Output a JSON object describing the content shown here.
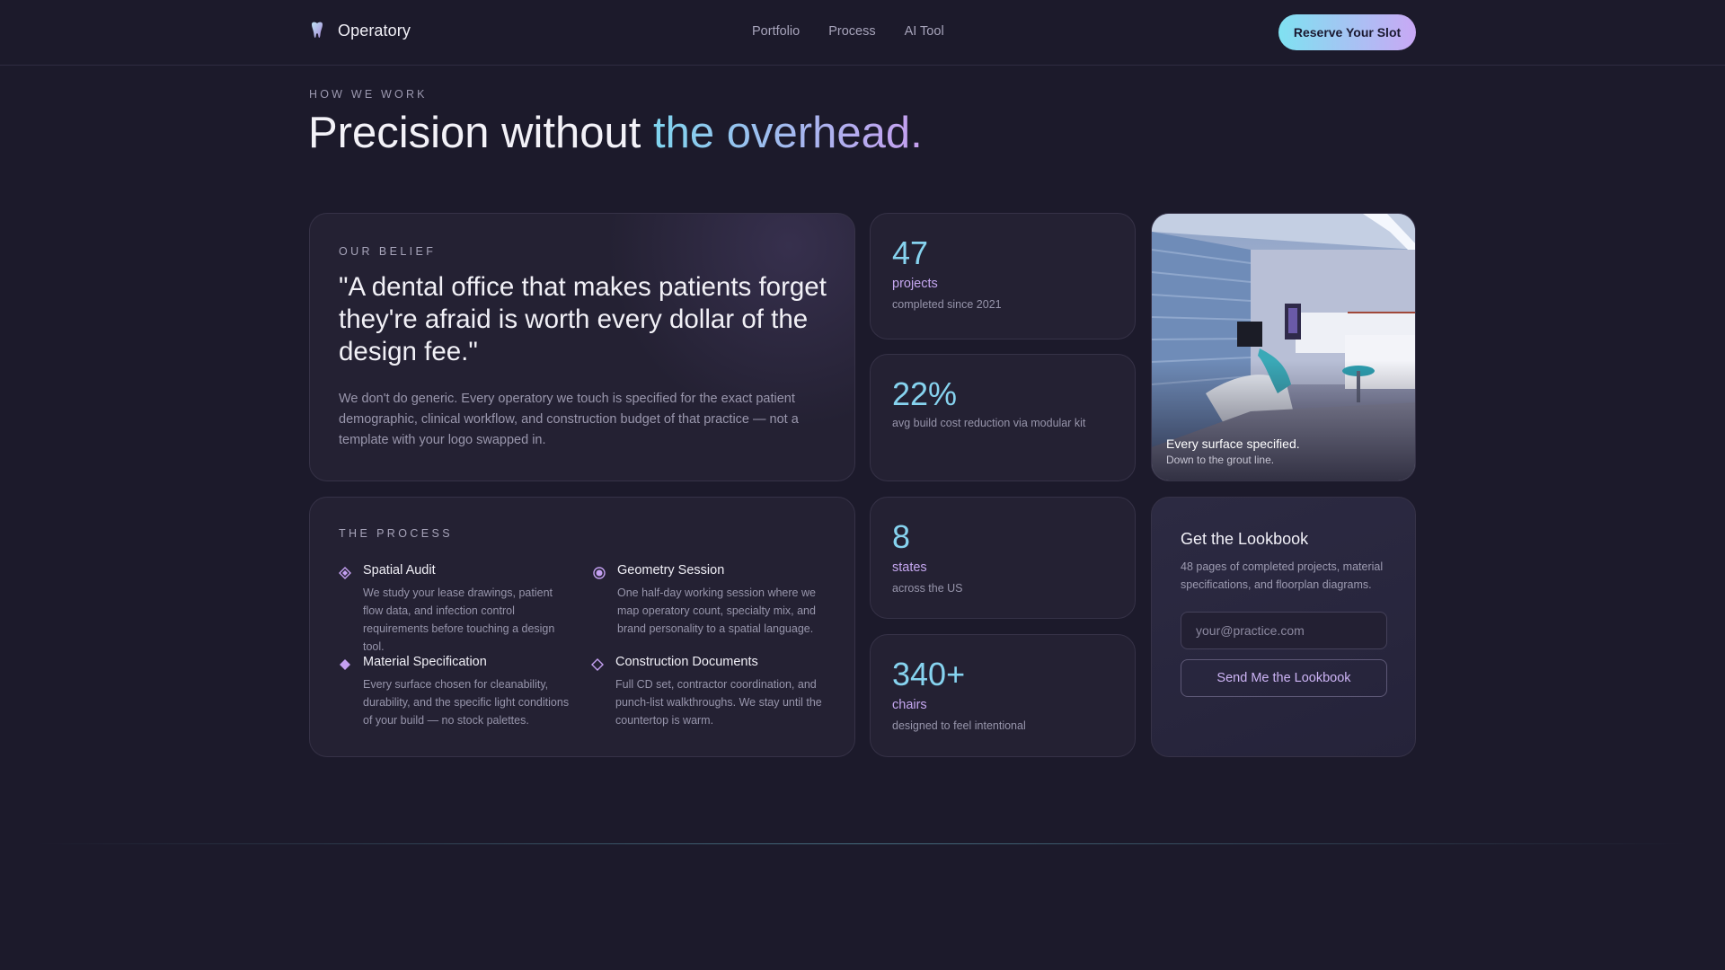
{
  "nav": {
    "brand": "Operatory",
    "links": [
      "Portfolio",
      "Process",
      "AI Tool"
    ],
    "cta": "Reserve Your Slot"
  },
  "hero": {
    "eyebrow": "HOW WE WORK",
    "headline_plain": "Precision without ",
    "headline_accent": "the overhead."
  },
  "belief": {
    "eyebrow": "OUR BELIEF",
    "quote": "\"A dental office that makes patients forget they're afraid is worth every dollar of the design fee.\"",
    "body": "We don't do generic. Every operatory we touch is specified for the exact patient demographic, clinical workflow, and construction budget of that practice — not a template with your logo swapped in."
  },
  "stats": [
    {
      "value": "47",
      "label": "projects",
      "sub": "completed since 2021"
    },
    {
      "value": "22%",
      "label": "",
      "sub": "avg build cost reduction via modular kit"
    },
    {
      "value": "8",
      "label": "states",
      "sub": "across the US"
    },
    {
      "value": "340+",
      "label": "chairs",
      "sub": "designed to feel intentional"
    }
  ],
  "photo": {
    "title": "Every surface specified.",
    "subtitle": "Down to the grout line."
  },
  "process": {
    "eyebrow": "THE PROCESS",
    "steps": [
      {
        "title": "Spatial Audit",
        "desc": "We study your lease drawings, patient flow data, and infection control requirements before touching a design tool.",
        "icon": "diamond-filled-icon"
      },
      {
        "title": "Geometry Session",
        "desc": "One half-day working session where we map operatory count, specialty mix, and brand personality to a spatial language.",
        "icon": "circle-dot-icon"
      },
      {
        "title": "Material Specification",
        "desc": "Every surface chosen for cleanability, durability, and the specific light conditions of your build — no stock palettes.",
        "icon": "diamond-solid-icon"
      },
      {
        "title": "Construction Documents",
        "desc": "Full CD set, contractor coordination, and punch-list walkthroughs. We stay until the countertop is warm.",
        "icon": "diamond-outline-icon"
      }
    ]
  },
  "lookbook": {
    "title": "Get the Lookbook",
    "desc": "48 pages of completed projects, material specifications, and floorplan diagrams.",
    "placeholder": "your@practice.com",
    "button": "Send Me the Lookbook"
  },
  "colors": {
    "background": "#1c1a2b",
    "card": "#242133",
    "accent_cyan": "#86d3ef",
    "accent_purple": "#c5a7f0"
  }
}
